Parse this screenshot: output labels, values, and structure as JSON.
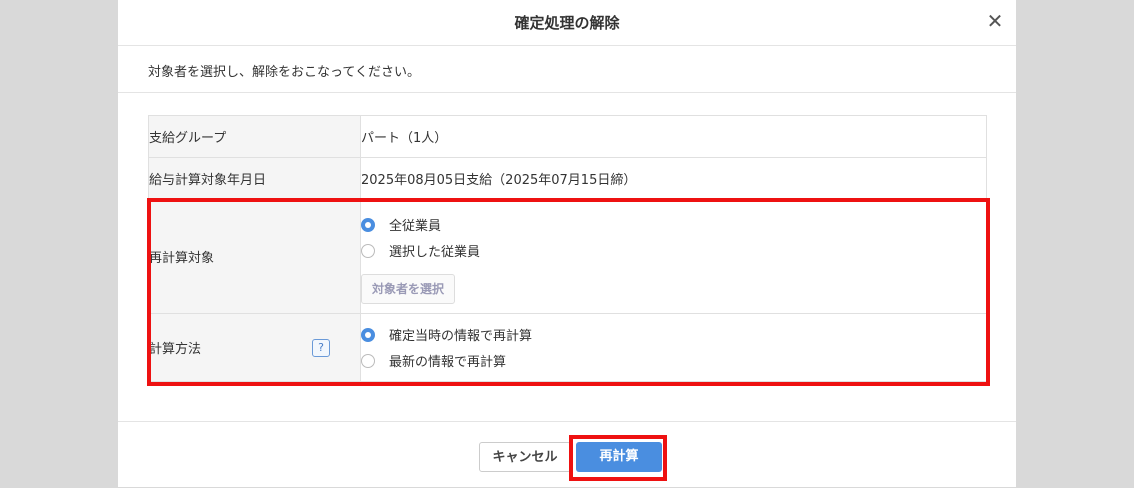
{
  "dialog": {
    "title": "確定処理の解除",
    "close_glyph": "✕",
    "instruction": "対象者を選択し、解除をおこなってください。"
  },
  "form": {
    "payment_group": {
      "label": "支給グループ",
      "value": "パート（1人）"
    },
    "target_date": {
      "label": "給与計算対象年月日",
      "value": "2025年08月05日支給（2025年07月15日締）"
    },
    "recalc_target": {
      "label": "再計算対象",
      "options": [
        {
          "label": "全従業員",
          "checked": true
        },
        {
          "label": "選択した従業員",
          "checked": false
        }
      ],
      "select_button": "対象者を選択"
    },
    "calc_method": {
      "label": "計算方法",
      "help": "?",
      "options": [
        {
          "label": "確定当時の情報で再計算",
          "checked": true
        },
        {
          "label": "最新の情報で再計算",
          "checked": false
        }
      ]
    }
  },
  "footer": {
    "cancel_label": "キャンセル",
    "recalc_label": "再計算"
  },
  "colors": {
    "accent": "#4a8ee0",
    "highlight": "#ee1111",
    "overlay": "#d9d9d9"
  }
}
